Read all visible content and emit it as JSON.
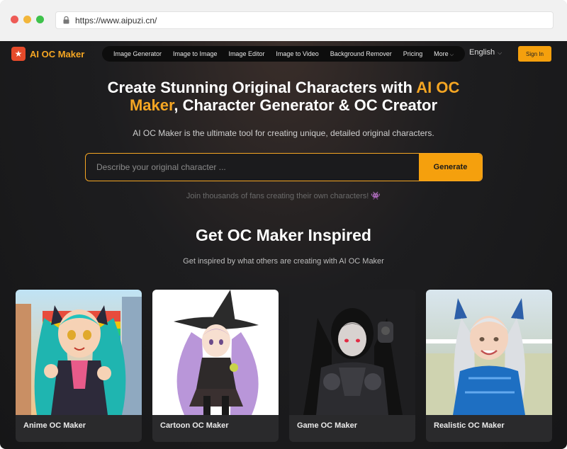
{
  "browser": {
    "url": "https://www.aipuzi.cn/"
  },
  "nav": {
    "logo_text": "AI OC Maker",
    "items": [
      {
        "label": "Image Generator"
      },
      {
        "label": "Image to Image"
      },
      {
        "label": "Image Editor"
      },
      {
        "label": "Image to Video"
      },
      {
        "label": "Background Remover"
      },
      {
        "label": "Pricing"
      },
      {
        "label": "More"
      }
    ],
    "language": "English",
    "signin_label": "Sign In"
  },
  "hero": {
    "title_part1": "Create Stunning Original Characters with ",
    "title_accent": "AI OC Maker",
    "title_part2": ", Character Generator & OC Creator",
    "subtitle": "AI OC Maker is the ultimate tool for creating unique, detailed original characters.",
    "search_placeholder": "Describe your original character ...",
    "generate_label": "Generate",
    "join_text": "Join thousands of fans creating their own characters!",
    "join_emoji": "👾"
  },
  "inspired": {
    "title": "Get OC Maker Inspired",
    "subtitle": "Get inspired by what others are creating with AI OC Maker",
    "cards": [
      {
        "label": "Anime OC Maker"
      },
      {
        "label": "Cartoon OC Maker"
      },
      {
        "label": "Game OC Maker"
      },
      {
        "label": "Realistic OC Maker"
      }
    ]
  },
  "colors": {
    "accent": "#f5a623",
    "button": "#f5a00d",
    "background": "#1d1d1f"
  }
}
